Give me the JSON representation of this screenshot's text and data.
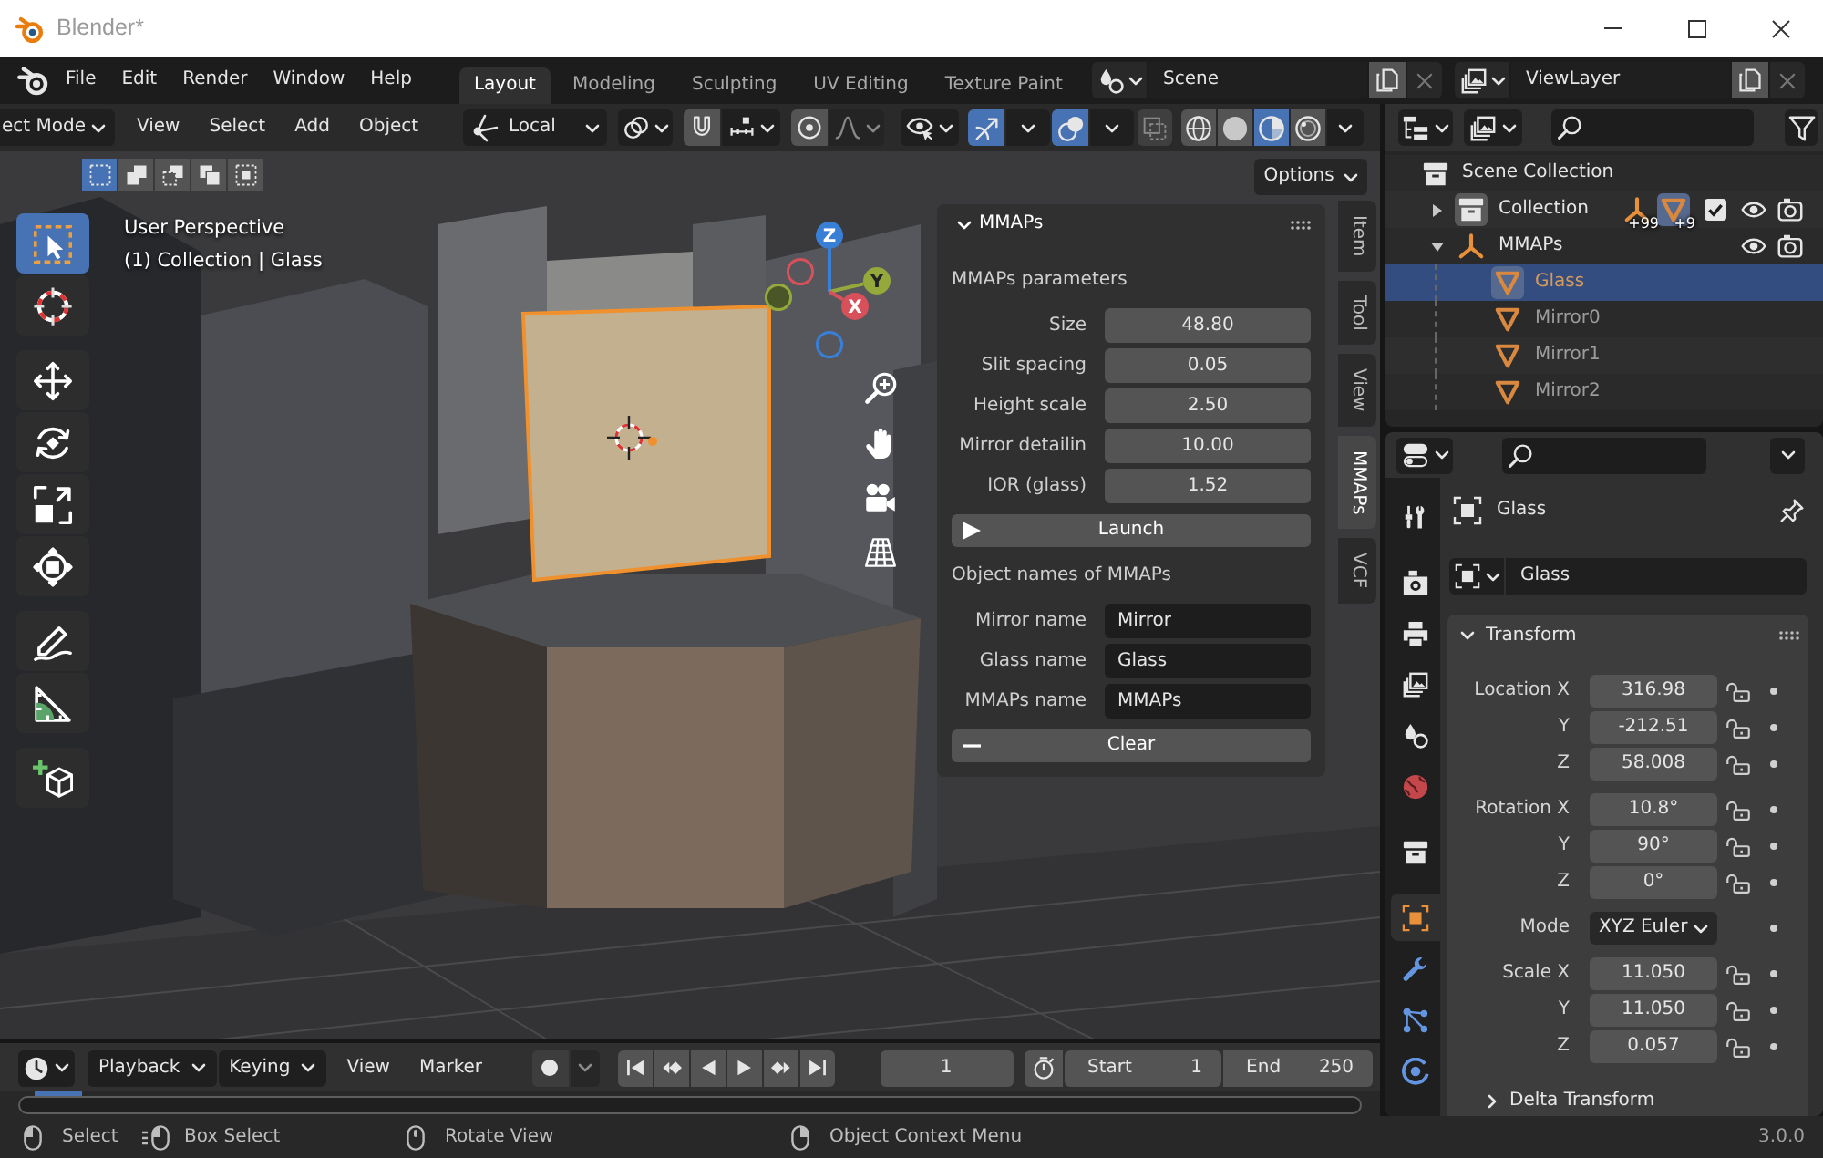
{
  "window": {
    "title": "Blender*"
  },
  "top_bar": {
    "menus": [
      "File",
      "Edit",
      "Render",
      "Window",
      "Help"
    ],
    "workspaces": [
      {
        "label": "Layout",
        "selected": true
      },
      {
        "label": "Modeling",
        "selected": false
      },
      {
        "label": "Sculpting",
        "selected": false
      },
      {
        "label": "UV Editing",
        "selected": false
      },
      {
        "label": "Texture Paint",
        "selected": false
      }
    ],
    "scene": "Scene",
    "view_layer": "ViewLayer"
  },
  "viewport": {
    "mode": "ect Mode",
    "menus": [
      "View",
      "Select",
      "Add",
      "Object"
    ],
    "orientation": "Local",
    "snap": {
      "on": false
    },
    "proportional": {
      "on": false
    },
    "gizmo": {
      "on": true
    },
    "overlays": {
      "on": true
    },
    "xray": {
      "on": false
    },
    "shading": [
      {
        "kind": "wireframe",
        "selected": false
      },
      {
        "kind": "solid",
        "selected": false
      },
      {
        "kind": "material",
        "selected": true
      },
      {
        "kind": "rendered",
        "selected": false
      }
    ],
    "select_modes": [
      {
        "kind": "set",
        "selected": true
      },
      {
        "kind": "extend",
        "selected": false
      },
      {
        "kind": "subtract",
        "selected": false
      },
      {
        "kind": "difference",
        "selected": false
      },
      {
        "kind": "intersect",
        "selected": false
      }
    ],
    "options": "Options",
    "view_name": "User Perspective",
    "context": "(1) Collection | Glass",
    "tool_groups": [
      {
        "tools": [
          {
            "kind": "select",
            "selected": true
          },
          {
            "kind": "cursor",
            "selected": false
          }
        ]
      },
      {
        "tools": [
          {
            "kind": "move",
            "selected": false
          },
          {
            "kind": "rotate",
            "selected": false
          },
          {
            "kind": "scale",
            "selected": false
          },
          {
            "kind": "transform",
            "selected": false
          }
        ]
      },
      {
        "tools": [
          {
            "kind": "annotate",
            "selected": false
          },
          {
            "kind": "measure",
            "selected": false
          }
        ]
      },
      {
        "tools": [
          {
            "kind": "add_cube",
            "selected": false
          }
        ]
      }
    ],
    "gizmo_axes": [
      "Z",
      "Y",
      "X"
    ]
  },
  "sidebar": {
    "tabs": [
      {
        "label": "Item",
        "selected": false
      },
      {
        "label": "Tool",
        "selected": false
      },
      {
        "label": "View",
        "selected": false
      },
      {
        "label": "MMAPs",
        "selected": true
      },
      {
        "label": "VCF",
        "selected": false
      }
    ],
    "panel": {
      "title": "MMAPs",
      "expanded": true,
      "sections": [
        {
          "heading": "MMAPs parameters",
          "fields": [
            {
              "label": "Size",
              "value": "48.80",
              "kind": "number"
            },
            {
              "label": "Slit spacing",
              "value": "0.05",
              "kind": "number"
            },
            {
              "label": "Height scale",
              "value": "2.50",
              "kind": "number"
            },
            {
              "label": "Mirror detailin",
              "value": "10.00",
              "kind": "number"
            },
            {
              "label": "IOR (glass)",
              "value": "1.52",
              "kind": "number"
            }
          ],
          "button": {
            "kind": "play",
            "label": "Launch"
          }
        },
        {
          "heading": "Object names of MMAPs",
          "fields": [
            {
              "label": "Mirror name",
              "value": "Mirror",
              "kind": "text"
            },
            {
              "label": "Glass name",
              "value": "Glass",
              "kind": "text"
            },
            {
              "label": "MMAPs name",
              "value": "MMAPs",
              "kind": "text"
            }
          ],
          "button": {
            "kind": "remove",
            "label": "Clear"
          }
        }
      ]
    }
  },
  "timeline": {
    "menus": [
      {
        "label": "Playback",
        "kind": "dropdown"
      },
      {
        "label": "Keying",
        "kind": "dropdown"
      },
      {
        "label": "View",
        "kind": "menu"
      },
      {
        "label": "Marker",
        "kind": "menu"
      }
    ],
    "current_frame": "1",
    "start": {
      "label": "Start",
      "value": "1"
    },
    "end": {
      "label": "End",
      "value": "250"
    }
  },
  "outliner": {
    "root": "Scene Collection",
    "items": [
      {
        "kind": "collection",
        "label": "Collection",
        "expanded": false,
        "selected": false,
        "active": true,
        "checked": true,
        "badges": [
          {
            "kind": "empty",
            "count": "+99",
            "active": false
          },
          {
            "kind": "mesh",
            "count": "+9",
            "active": true
          }
        ]
      },
      {
        "kind": "empty",
        "label": "MMAPs",
        "expanded": true,
        "selected": false,
        "active": false,
        "children": [
          {
            "kind": "mesh",
            "label": "Glass",
            "selected": true,
            "active": true
          },
          {
            "kind": "mesh",
            "label": "Mirror0",
            "selected": false,
            "active": false
          },
          {
            "kind": "mesh",
            "label": "Mirror1",
            "selected": false,
            "active": false
          },
          {
            "kind": "mesh",
            "label": "Mirror2",
            "selected": false,
            "active": false
          }
        ]
      }
    ]
  },
  "properties": {
    "tab_groups": [
      {
        "tabs": [
          {
            "kind": "tool",
            "selected": false
          }
        ]
      },
      {
        "tabs": [
          {
            "kind": "render",
            "selected": false
          },
          {
            "kind": "output",
            "selected": false
          },
          {
            "kind": "view_layer",
            "selected": false
          },
          {
            "kind": "scene",
            "selected": false
          },
          {
            "kind": "world",
            "selected": false
          }
        ]
      },
      {
        "tabs": [
          {
            "kind": "collection",
            "selected": false
          }
        ]
      },
      {
        "tabs": [
          {
            "kind": "object",
            "selected": true
          },
          {
            "kind": "modifiers",
            "selected": false
          },
          {
            "kind": "particles",
            "selected": false
          },
          {
            "kind": "physics",
            "selected": false
          }
        ]
      }
    ],
    "object": "Glass",
    "datablock": "Glass",
    "transform": {
      "title": "Transform",
      "expanded": true,
      "groups": [
        {
          "rows": [
            {
              "label": "Location X",
              "value": "316.98",
              "kind": "number"
            },
            {
              "label": "Y",
              "value": "-212.51",
              "kind": "number"
            },
            {
              "label": "Z",
              "value": "58.008",
              "kind": "number"
            }
          ]
        },
        {
          "rows": [
            {
              "label": "Rotation X",
              "value": "10.8°",
              "kind": "number"
            },
            {
              "label": "Y",
              "value": "90°",
              "kind": "number"
            },
            {
              "label": "Z",
              "value": "0°",
              "kind": "number"
            }
          ]
        },
        {
          "rows": [
            {
              "label": "Mode",
              "value": "XYZ Euler",
              "kind": "dropdown"
            }
          ]
        },
        {
          "rows": [
            {
              "label": "Scale X",
              "value": "11.050",
              "kind": "number"
            },
            {
              "label": "Y",
              "value": "11.050",
              "kind": "number"
            },
            {
              "label": "Z",
              "value": "0.057",
              "kind": "number"
            }
          ]
        }
      ],
      "subpanel": {
        "title": "Delta Transform",
        "expanded": false
      }
    }
  },
  "status_bar": {
    "hints": [
      {
        "kind": "mouse_left",
        "label": "Select"
      },
      {
        "kind": "mouse_drag",
        "label": "Box Select"
      },
      {
        "kind": "mouse_middle",
        "label": "Rotate View"
      },
      {
        "kind": "mouse_right",
        "label": "Object Context Menu"
      }
    ],
    "version": "3.0.0"
  }
}
